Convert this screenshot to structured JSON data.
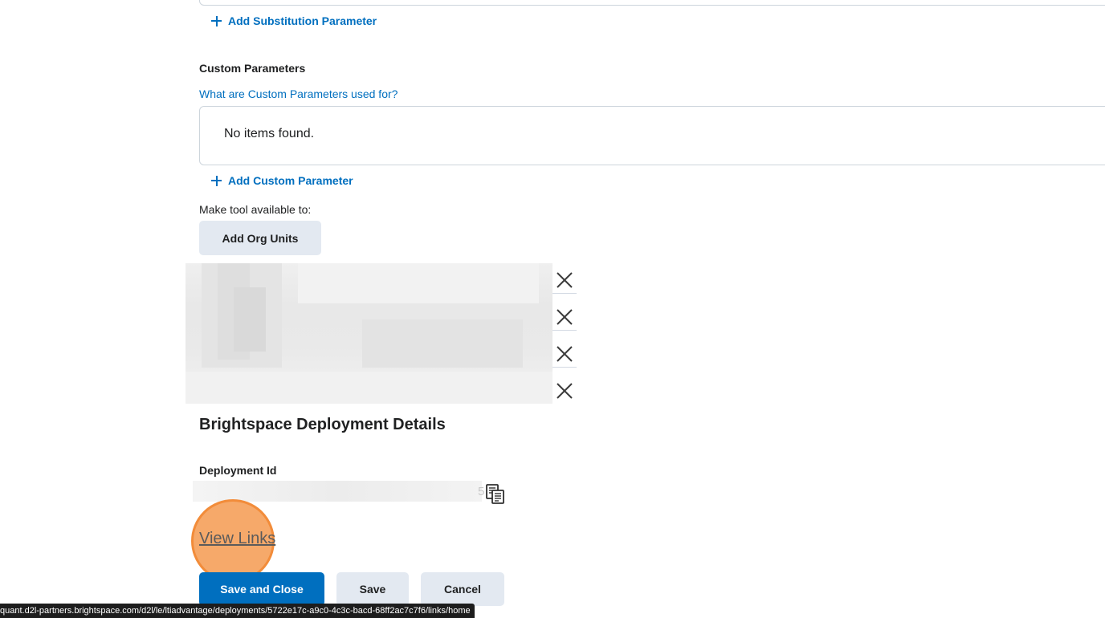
{
  "substitution": {
    "add_label": "Add Substitution Parameter"
  },
  "custom_params": {
    "title": "Custom Parameters",
    "help_link": "What are Custom Parameters used for?",
    "empty_text": "No items found.",
    "add_label": "Add Custom Parameter"
  },
  "availability": {
    "label": "Make tool available to:",
    "add_org_units_label": "Add Org Units",
    "org_unit_rows": 4
  },
  "deployment": {
    "heading": "Brightspace Deployment Details",
    "id_label": "Deployment Id",
    "id_visible_tail": "5",
    "view_links_label": "View Links"
  },
  "actions": {
    "save_and_close": "Save and Close",
    "save": "Save",
    "cancel": "Cancel"
  },
  "status_bar": {
    "url": "quant.d2l-partners.brightspace.com/d2l/le/ltiadvantage/deployments/5722e17c-a9c0-4c3c-bacd-68ff2ac7c7f6/links/home"
  },
  "colors": {
    "link": "#006fbf",
    "primary_button": "#006fbf",
    "secondary_button": "#e3e9f1",
    "highlight": "#f49a50"
  },
  "icons": {
    "plus": "plus-icon",
    "remove": "close-icon",
    "copy": "copy-icon"
  }
}
